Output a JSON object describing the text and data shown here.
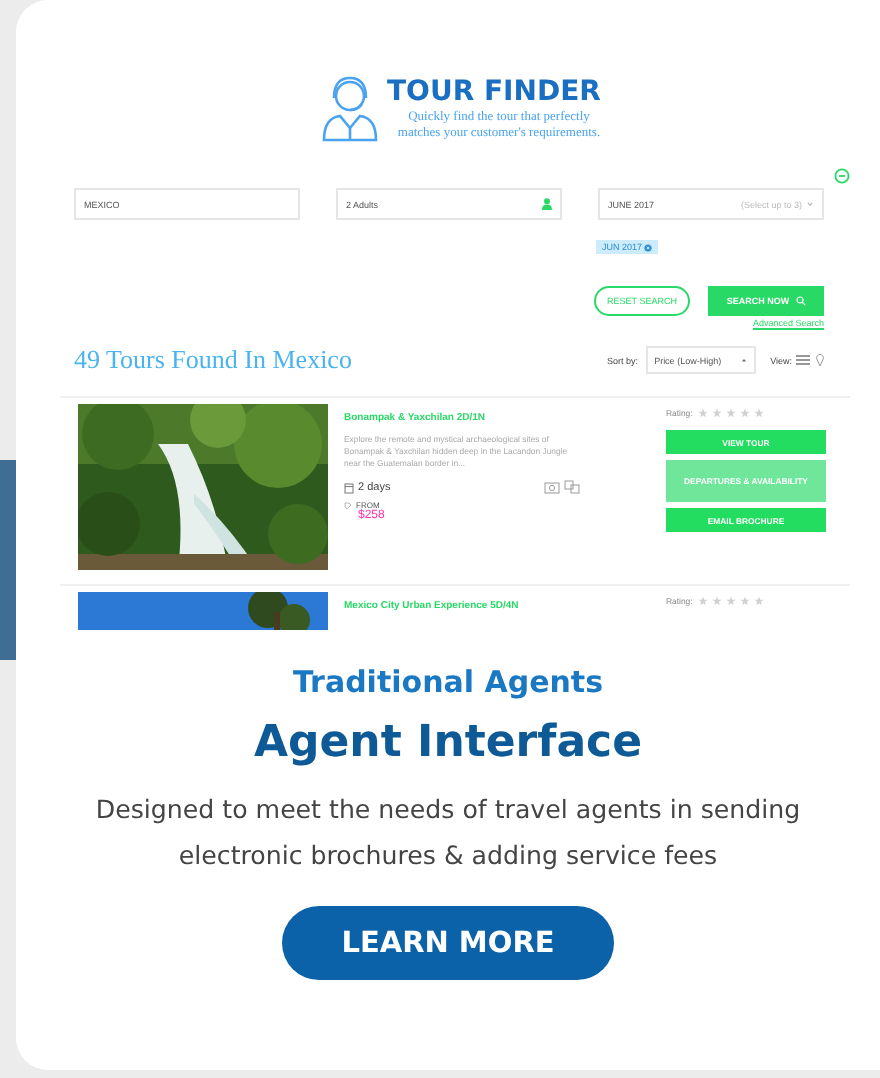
{
  "logo": {
    "title": "TOUR FINDER",
    "tagline": "Quickly find the tour that perfectly matches your customer's requirements."
  },
  "search": {
    "fields": [
      {
        "kind": "text",
        "value": "MEXICO"
      },
      {
        "kind": "guests",
        "value": "2 Adults"
      },
      {
        "kind": "month",
        "value": "JUNE 2017",
        "hint": "(Select up to 3)"
      }
    ],
    "tags": [
      {
        "label": "JUN 2017"
      }
    ],
    "reset_button": "RESET SEARCH",
    "search_button": "SEARCH NOW",
    "advanced_link": "Advanced Search"
  },
  "results_heading": "49 Tours Found In Mexico",
  "sort": {
    "label": "Sort by:",
    "value": "Price (Low-High)"
  },
  "view_label": "View:",
  "results": [
    {
      "kind": "waterfall",
      "title": "Bonampak & Yaxchilan 2D/1N",
      "description": "Explore the remote and mystical archaeological sites of Bonampak & Yaxchilan hidden deep in the Lacandon Jungle near the Guatemalan border in...",
      "duration": "2 days",
      "from_label": "FROM",
      "price": "$258",
      "rating_label": "Rating:",
      "stars": 0,
      "actions": [
        {
          "kind": "primary",
          "label": "VIEW TOUR"
        },
        {
          "kind": "secondary",
          "label": "DEPARTURES & AVAILABILITY"
        },
        {
          "kind": "primary",
          "label": "EMAIL BROCHURE"
        }
      ]
    },
    {
      "kind": "sky",
      "title": "Mexico City Urban Experience 5D/4N",
      "rating_label": "Rating:",
      "stars": 0
    }
  ],
  "promo": {
    "eyebrow": "Traditional Agents",
    "title": "Agent Interface",
    "description": "Designed to meet the needs of travel agents in sending electronic brochures & adding service fees",
    "button": "LEARN MORE"
  }
}
